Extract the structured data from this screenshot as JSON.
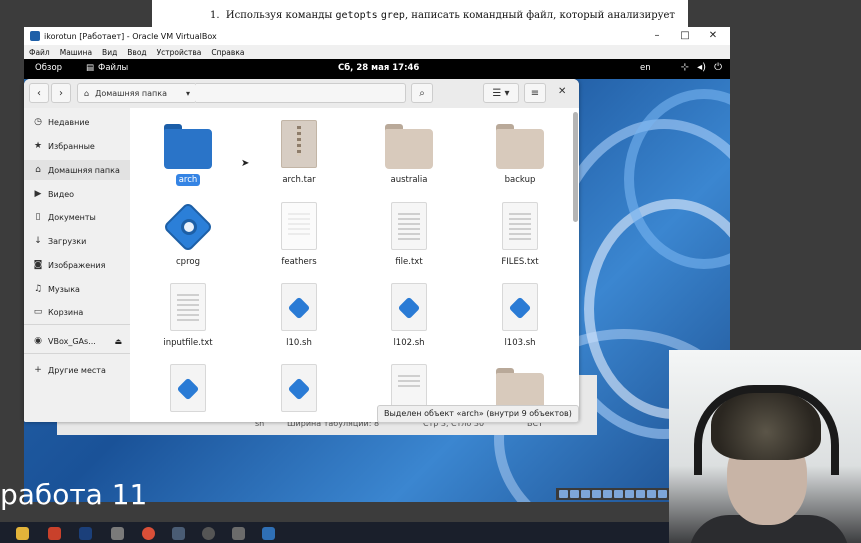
{
  "document": {
    "numbered_line_number": "1.",
    "line_prefix": "Используя команды",
    "command_1": "getopts",
    "command_2": "grep",
    "line_suffix": ", написать командный файл, который анализирует"
  },
  "vbox_window": {
    "title": "ikorotun [Работает] - Oracle VM VirtualBox",
    "minimize": "–",
    "maximize": "□",
    "close": "✕",
    "menu": [
      "Файл",
      "Машина",
      "Вид",
      "Ввод",
      "Устройства",
      "Справка"
    ]
  },
  "gnome_bar": {
    "overview": "Обзор",
    "app_name": "Файлы",
    "clock": "Сб, 28 мая  17:46",
    "lang": "en"
  },
  "file_manager": {
    "path_label": "Домашняя папка",
    "sidebar": [
      {
        "label": "Недавние",
        "icon": "clock-icon",
        "glyph": "◷"
      },
      {
        "label": "Избранные",
        "icon": "star-icon",
        "glyph": "★"
      },
      {
        "label": "Домашняя папка",
        "icon": "home-icon",
        "glyph": "⌂"
      },
      {
        "label": "Видео",
        "icon": "video-icon",
        "glyph": "▶"
      },
      {
        "label": "Документы",
        "icon": "document-icon",
        "glyph": "▯"
      },
      {
        "label": "Загрузки",
        "icon": "download-icon",
        "glyph": "↓"
      },
      {
        "label": "Изображения",
        "icon": "image-icon",
        "glyph": "◙"
      },
      {
        "label": "Музыка",
        "icon": "music-icon",
        "glyph": "♫"
      },
      {
        "label": "Корзина",
        "icon": "trash-icon",
        "glyph": "▭"
      },
      {
        "label": "VBox_GAs...",
        "icon": "disc-icon",
        "glyph": "◉"
      },
      {
        "label": "Другие места",
        "icon": "plus-icon",
        "glyph": "+"
      }
    ],
    "files": [
      {
        "name": "arch",
        "kind": "folder-blue"
      },
      {
        "name": "arch.tar",
        "kind": "archive"
      },
      {
        "name": "australia",
        "kind": "folder"
      },
      {
        "name": "backup",
        "kind": "folder"
      },
      {
        "name": "cprog",
        "kind": "executable"
      },
      {
        "name": "feathers",
        "kind": "text-empty"
      },
      {
        "name": "file.txt",
        "kind": "text"
      },
      {
        "name": "FILES.txt",
        "kind": "text"
      },
      {
        "name": "inputfile.txt",
        "kind": "text"
      },
      {
        "name": "l10.sh",
        "kind": "script"
      },
      {
        "name": "l102.sh",
        "kind": "script"
      },
      {
        "name": "l103.sh",
        "kind": "script"
      }
    ],
    "status": "Выделен объект «arch» (внутри 9 объектов)"
  },
  "behind_window_status": {
    "lang": "sh",
    "tab_width": "Ширина табуляции: 8",
    "position": "Стр 3, Стлб 30",
    "mode": "ВСТ"
  },
  "presentation_text": "работа 11"
}
